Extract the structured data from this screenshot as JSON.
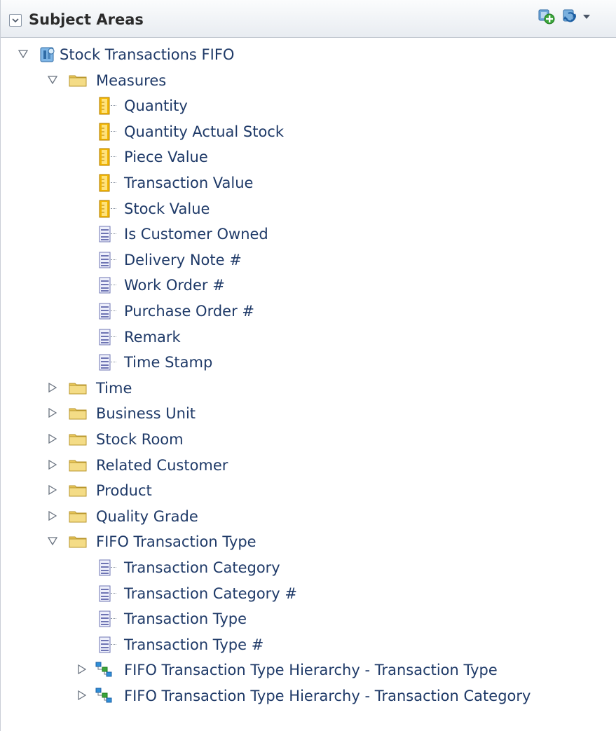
{
  "header": {
    "title": "Subject Areas",
    "collapse_icon": "chevron-down-icon",
    "add_icon": "add-subject-area-icon",
    "refresh_icon": "refresh-icon",
    "dropdown_icon": "caret-down-icon"
  },
  "tree": {
    "root": {
      "label": "Stock Transactions FIFO",
      "expanded": true,
      "icon": "subject-area-cube-icon"
    },
    "measures": {
      "label": "Measures",
      "expanded": true,
      "items": [
        {
          "label": "Quantity",
          "kind": "measure"
        },
        {
          "label": "Quantity Actual Stock",
          "kind": "measure"
        },
        {
          "label": "Piece Value",
          "kind": "measure"
        },
        {
          "label": "Transaction Value",
          "kind": "measure"
        },
        {
          "label": "Stock Value",
          "kind": "measure"
        },
        {
          "label": "Is Customer Owned",
          "kind": "attribute"
        },
        {
          "label": "Delivery Note #",
          "kind": "attribute"
        },
        {
          "label": "Work Order #",
          "kind": "attribute"
        },
        {
          "label": "Purchase Order #",
          "kind": "attribute"
        },
        {
          "label": "Remark",
          "kind": "attribute"
        },
        {
          "label": "Time Stamp",
          "kind": "attribute"
        }
      ]
    },
    "folders": [
      {
        "label": "Time",
        "expanded": false
      },
      {
        "label": "Business Unit",
        "expanded": false
      },
      {
        "label": "Stock Room",
        "expanded": false
      },
      {
        "label": "Related Customer",
        "expanded": false
      },
      {
        "label": "Product",
        "expanded": false
      },
      {
        "label": "Quality Grade",
        "expanded": false
      }
    ],
    "fifo": {
      "label": "FIFO Transaction Type",
      "expanded": true,
      "items": [
        {
          "label": "Transaction Category"
        },
        {
          "label": "Transaction Category #"
        },
        {
          "label": "Transaction Type"
        },
        {
          "label": "Transaction Type #"
        }
      ],
      "hierarchies": [
        {
          "label": "FIFO Transaction Type Hierarchy - Transaction Type",
          "expanded": false
        },
        {
          "label": "FIFO Transaction Type Hierarchy - Transaction Category",
          "expanded": false
        }
      ]
    }
  },
  "colors": {
    "text": "#1f3a68",
    "folder": "#e9c75a",
    "measure": "#f2b705",
    "attribute": "#8a8fc9",
    "header_bg": "#e8ecf1"
  }
}
